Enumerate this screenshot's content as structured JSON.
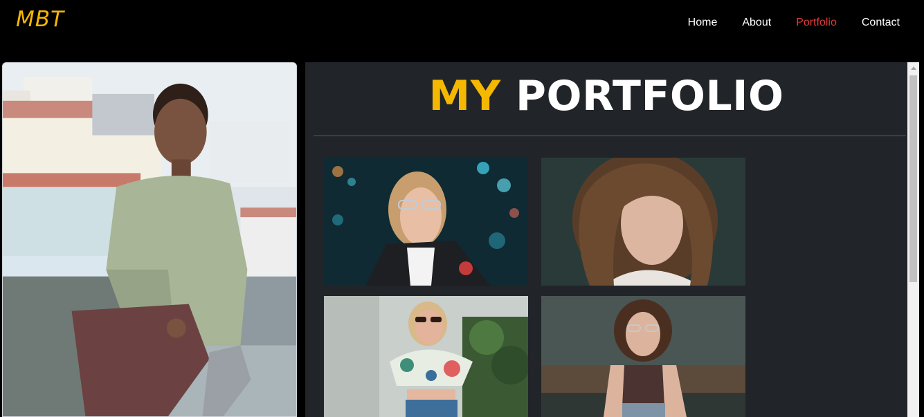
{
  "navbar": {
    "brand": "MBT",
    "links": [
      {
        "label": "Home",
        "active": false
      },
      {
        "label": "About",
        "active": false
      },
      {
        "label": "Portfolio",
        "active": true
      },
      {
        "label": "Contact",
        "active": false
      }
    ]
  },
  "profile": {
    "photo": "profile-photo-of-young-man-sitting-on-rooftop"
  },
  "portfolio": {
    "title_accent": "MY",
    "title_rest": "PORTFOLIO",
    "photos": [
      "woman-with-glasses-city-lights",
      "woman-with-curly-hair",
      "woman-in-sunglasses-floral-top",
      "woman-with-glasses-sitting"
    ]
  },
  "colors": {
    "accent": "#f5b800",
    "active_link": "#e03a3a",
    "panel_bg": "#212429",
    "page_bg": "#000000"
  }
}
